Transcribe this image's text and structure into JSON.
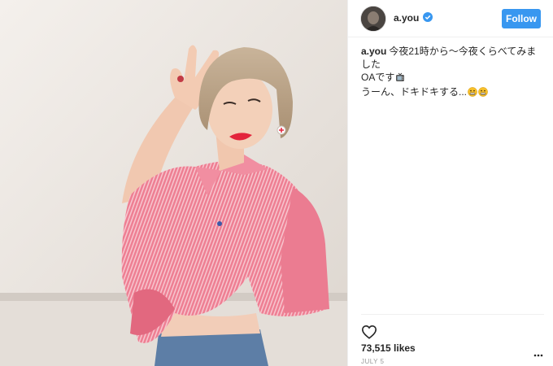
{
  "post": {
    "username": "a.you",
    "follow_label": "Follow",
    "caption": {
      "author": "a.you",
      "line1": "今夜21時から〜今夜くらべてみました",
      "line2": "OAです",
      "line3": "うーん、ドキドキする..."
    },
    "likes": "73,515 likes",
    "date": "JULY 5"
  },
  "icons": {
    "verified": "verified-badge-icon",
    "tv": "tv-icon",
    "emoji": "grimacing-face-icon",
    "heart": "heart-icon",
    "more": "more-options-icon"
  },
  "colors": {
    "follow_button": "#3897f0",
    "verified_badge": "#3897f0",
    "shirt": "#ea6f86",
    "lipstick": "#e3243b"
  }
}
